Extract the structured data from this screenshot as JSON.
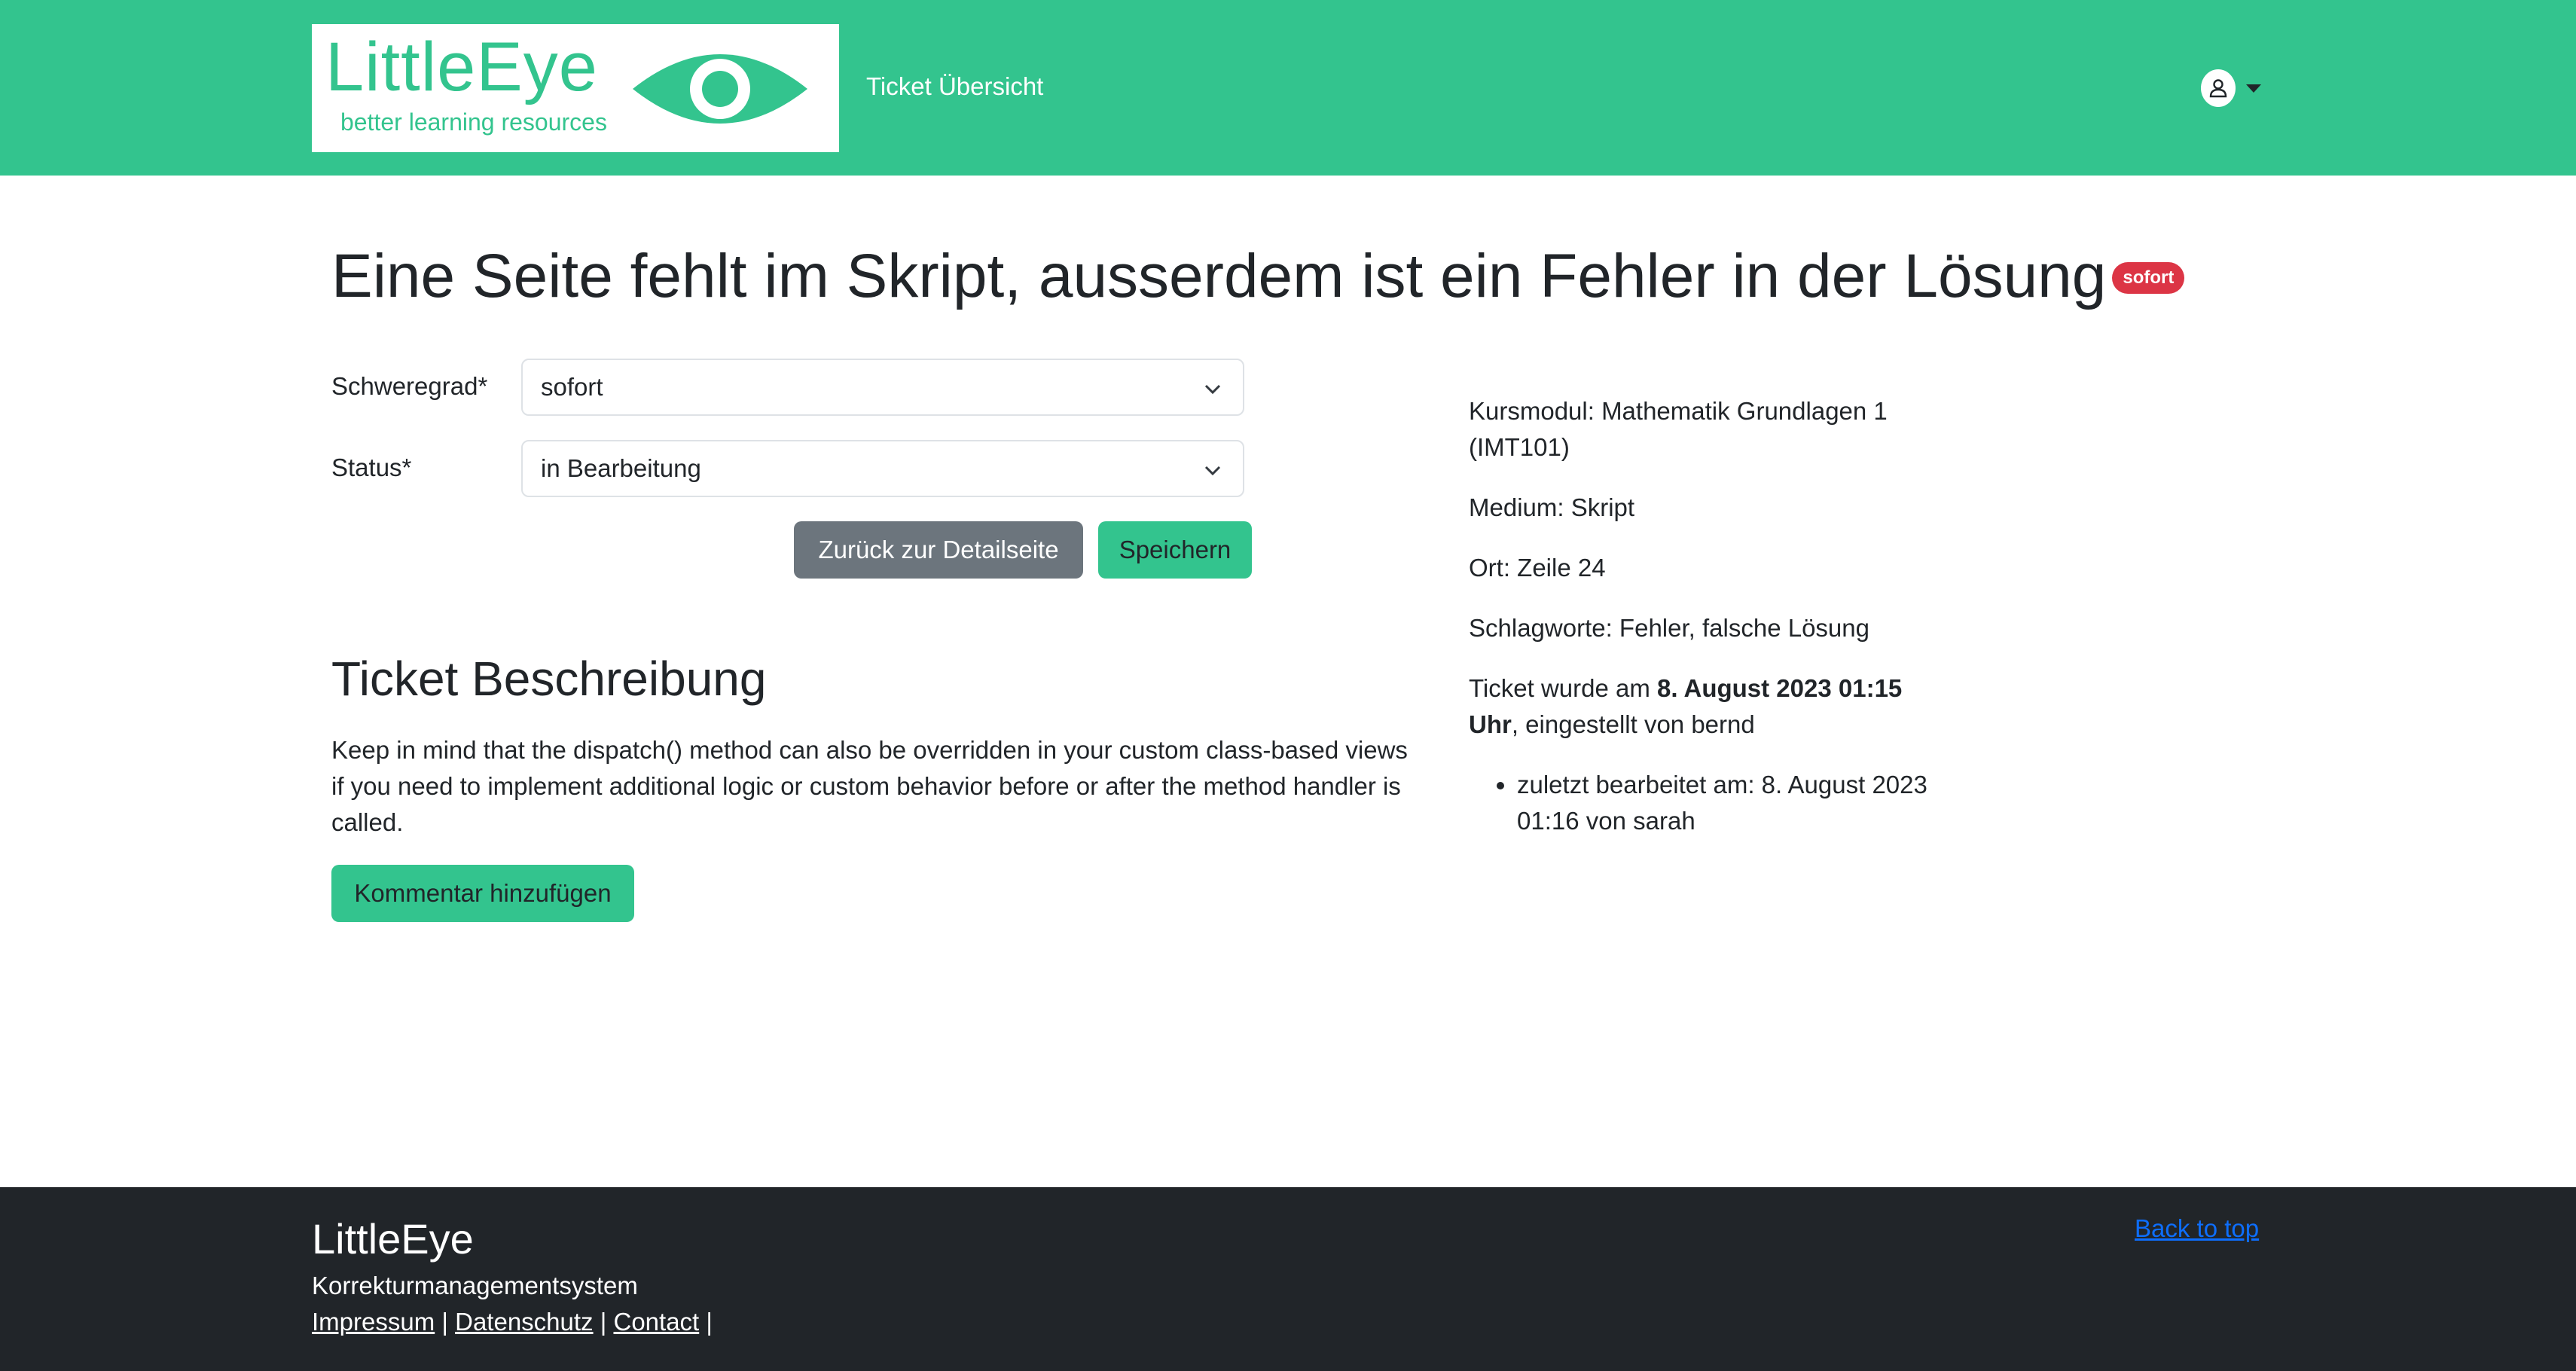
{
  "brand": {
    "name": "LittleEye",
    "tagline": "better learning resources",
    "color": "#33c48e"
  },
  "nav": {
    "ticket_overview": "Ticket Übersicht",
    "user_icon": "user-circle-icon"
  },
  "ticket": {
    "title": "Eine Seite fehlt im Skript, ausserdem ist ein Fehler in der Lösung",
    "priority_badge": "sofort",
    "badge_color": "#dc3545"
  },
  "form": {
    "severity_label": "Schweregrad*",
    "severity_value": "sofort",
    "status_label": "Status*",
    "status_value": "in Bearbeitung",
    "back_button": "Zurück zur Detailseite",
    "save_button": "Speichern"
  },
  "description": {
    "heading": "Ticket Beschreibung",
    "text": "Keep in mind that the dispatch() method can also be overridden in your custom class-based views if you need to implement additional logic or custom behavior before or after the method handler is called.",
    "add_comment_button": "Kommentar hinzufügen"
  },
  "details": {
    "course_module": "Kursmodul: Mathematik Grundlagen 1 (IMT101)",
    "medium": "Medium: Skript",
    "location": "Ort: Zeile 24",
    "tags": "Schlagworte: Fehler, falsche Lösung",
    "created_prefix": "Ticket wurde am ",
    "created_date": "8. August 2023 01:15 Uhr",
    "created_suffix": ", eingestellt von bernd",
    "history": [
      "zuletzt bearbeitet am: 8. August 2023 01:16 von sarah"
    ]
  },
  "footer": {
    "brand": "LittleEye",
    "subtitle": "Korrekturmanagementsystem",
    "links": [
      "Impressum",
      "Datenschutz",
      "Contact"
    ],
    "separator": " | ",
    "trailing_separator": " |",
    "back_to_top": "Back to top"
  }
}
